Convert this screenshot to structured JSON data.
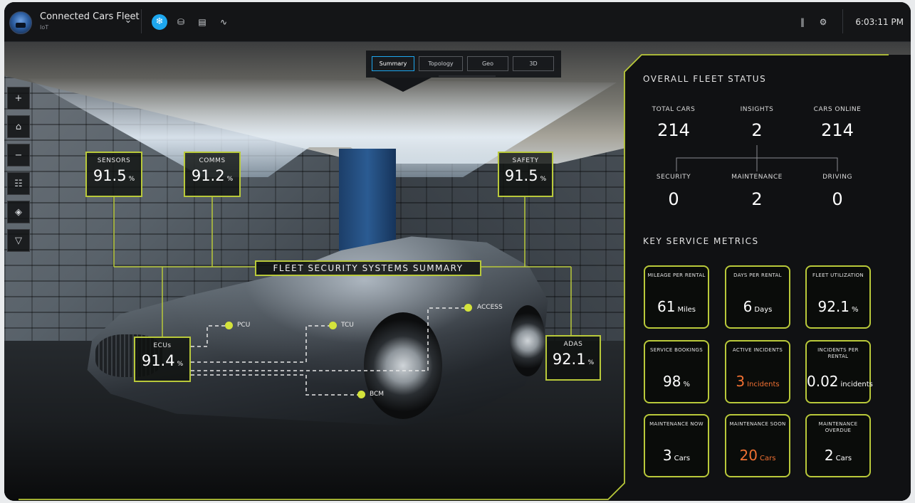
{
  "app": {
    "title": "Connected Cars Fleet",
    "subtitle": "IoT"
  },
  "toolbar": {
    "icons": [
      "snowflake-icon",
      "database-icon",
      "chart-icon",
      "activity-icon"
    ],
    "right_icons": [
      "pause-icon",
      "gear-icon"
    ],
    "clock": "6:03:11 PM"
  },
  "view_tabs": [
    {
      "label": "Summary",
      "active": true
    },
    {
      "label": "Topology",
      "active": false
    },
    {
      "label": "Geo",
      "active": false
    },
    {
      "label": "3D",
      "active": false
    }
  ],
  "side_tools": [
    "plus-icon",
    "home-icon",
    "minus-icon",
    "hierarchy-icon",
    "layers-icon",
    "filter-icon"
  ],
  "overlays": {
    "sensors": {
      "label": "SENSORS",
      "value": "91.5",
      "unit": "%"
    },
    "comms": {
      "label": "COMMS",
      "value": "91.2",
      "unit": "%"
    },
    "safety": {
      "label": "SAFETY",
      "value": "91.5",
      "unit": "%"
    },
    "ecus": {
      "label": "ECUs",
      "value": "91.4",
      "unit": "%"
    },
    "adas": {
      "label": "ADAS",
      "value": "92.1",
      "unit": "%"
    },
    "summary_title": "FLEET SECURITY SYSTEMS SUMMARY",
    "points": {
      "pcu": "PCU",
      "tcu": "TCU",
      "access": "ACCESS",
      "bcm": "BCM"
    }
  },
  "fleet_status": {
    "title": "OVERALL FLEET STATUS",
    "total_cars": {
      "label": "TOTAL CARS",
      "value": "214"
    },
    "insights": {
      "label": "INSIGHTS",
      "value": "2"
    },
    "cars_online": {
      "label": "CARS ONLINE",
      "value": "214"
    },
    "security": {
      "label": "SECURITY",
      "value": "0"
    },
    "maintenance": {
      "label": "MAINTENANCE",
      "value": "2"
    },
    "driving": {
      "label": "DRIVING",
      "value": "0"
    }
  },
  "key_metrics": {
    "title": "KEY SERVICE METRICS",
    "items": [
      {
        "label": "MILEAGE PER RENTAL",
        "value": "61",
        "unit": "Miles",
        "warn": false
      },
      {
        "label": "DAYS PER RENTAL",
        "value": "6",
        "unit": "Days",
        "warn": false
      },
      {
        "label": "FLEET UTILIZATION",
        "value": "92.1",
        "unit": "%",
        "warn": false
      },
      {
        "label": "SERVICE BOOKINGS",
        "value": "98",
        "unit": "%",
        "warn": false
      },
      {
        "label": "ACTIVE INCIDENTS",
        "value": "3",
        "unit": "Incidents",
        "warn": true
      },
      {
        "label": "INCIDENTS PER RENTAL",
        "value": "0.02",
        "unit": "incidents",
        "warn": false
      },
      {
        "label": "MAINTENANCE NOW",
        "value": "3",
        "unit": "Cars",
        "warn": false
      },
      {
        "label": "MAINTENANCE SOON",
        "value": "20",
        "unit": "Cars",
        "warn": true
      },
      {
        "label": "MAINTENANCE OVERDUE",
        "value": "2",
        "unit": "Cars",
        "warn": false
      }
    ]
  },
  "colors": {
    "accent": "#b9c93a",
    "active_blue": "#1da7ef",
    "warn": "#f07032",
    "dot": "#d4e33b"
  }
}
